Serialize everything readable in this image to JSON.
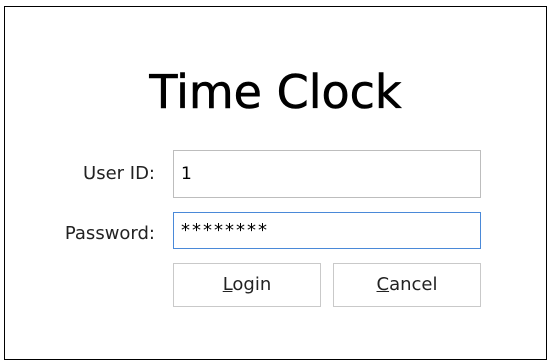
{
  "dialog": {
    "title": "Time Clock",
    "user_id_label": "User ID:",
    "user_id_value": "1",
    "password_label": "Password:",
    "password_value": "********",
    "login_button": {
      "mnemonic": "L",
      "rest": "ogin"
    },
    "cancel_button": {
      "mnemonic": "C",
      "rest": "ancel"
    }
  },
  "colors": {
    "focus_border": "#4a89d8",
    "field_border": "#bdbdbd",
    "button_border": "#c9c9c9"
  }
}
